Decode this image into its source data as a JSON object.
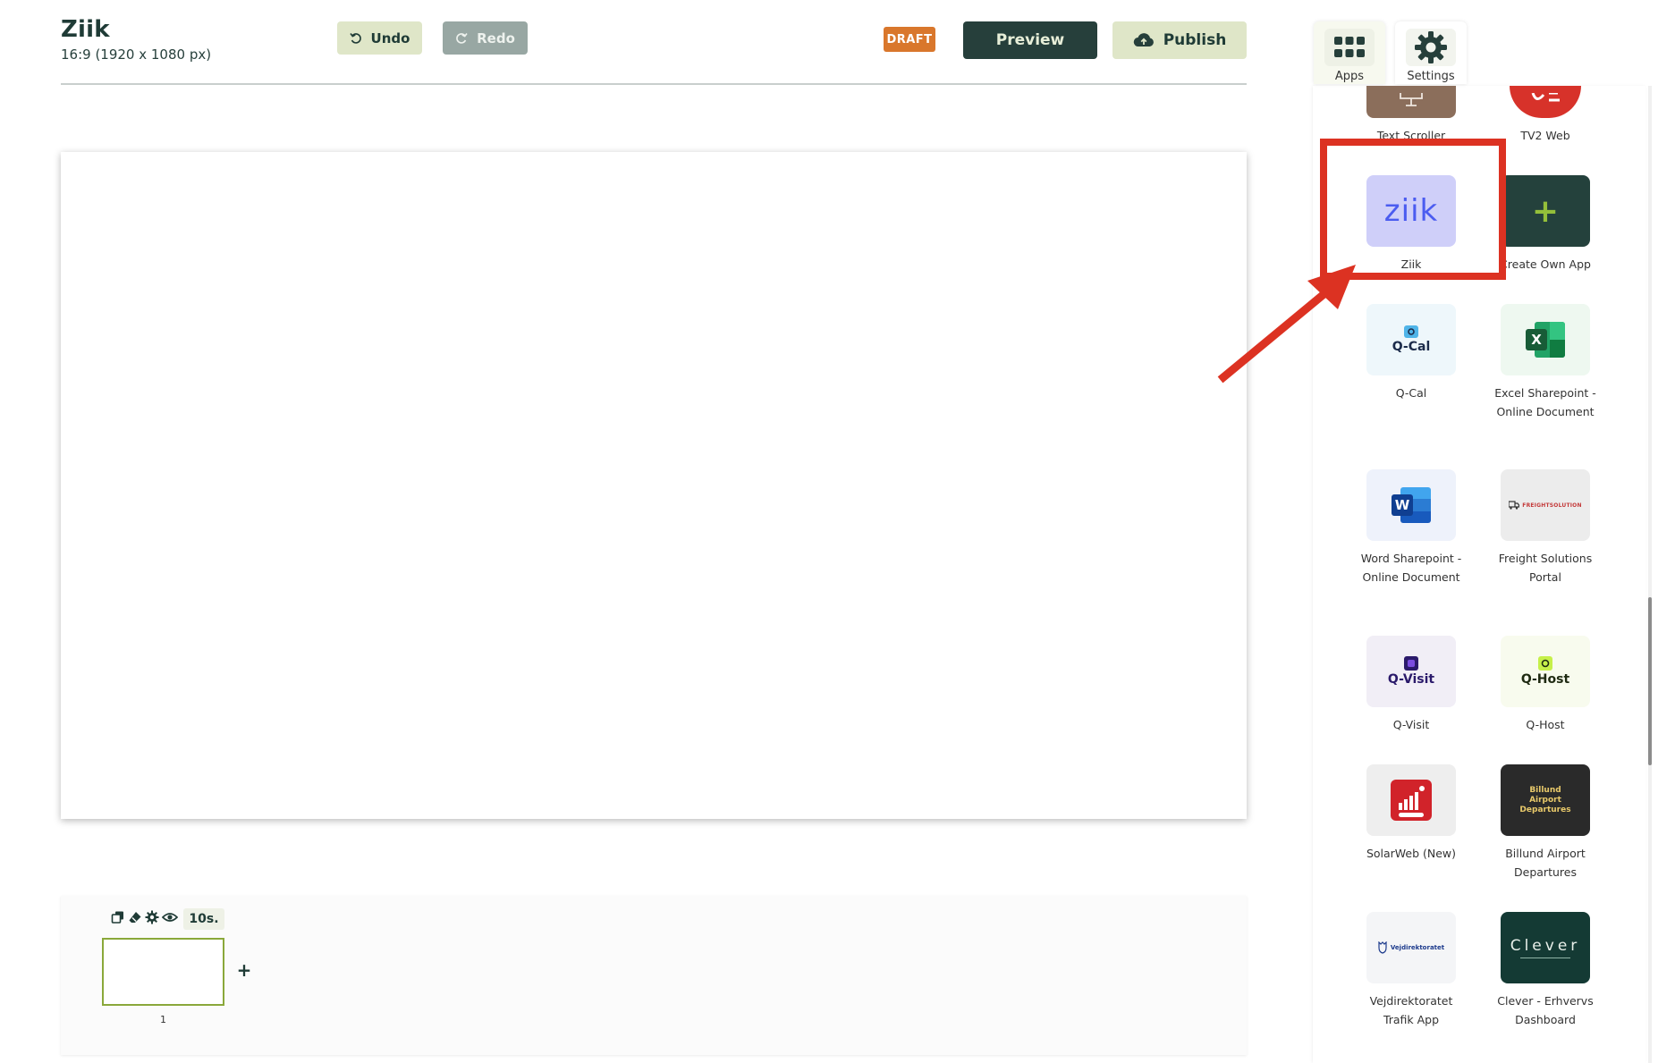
{
  "header": {
    "title": "Ziik",
    "subtitle": "16:9 (1920 x 1080 px)",
    "undo_label": "Undo",
    "redo_label": "Redo",
    "status_badge": "DRAFT",
    "preview_label": "Preview",
    "publish_label": "Publish"
  },
  "timeline": {
    "duration": "10s.",
    "slide_number": "1",
    "add_slide": "+"
  },
  "panel": {
    "tabs": [
      {
        "label": "Apps",
        "icon": "apps-grid-icon",
        "active": true
      },
      {
        "label": "Settings",
        "icon": "gear-icon",
        "active": false
      }
    ],
    "apps": [
      {
        "label": "Text Scroller"
      },
      {
        "label": "TV2 Web"
      },
      {
        "label": "Ziik",
        "logo_text": "ziik"
      },
      {
        "label": "Create Own App",
        "logo_text": "+"
      },
      {
        "label": "Q-Cal",
        "logo_text": "Q-Cal"
      },
      {
        "label": "Excel Sharepoint - Online Document",
        "logo_text": "X"
      },
      {
        "label": "Word Sharepoint - Online Document",
        "logo_text": "W"
      },
      {
        "label": "Freight Solutions Portal",
        "logo_text": "FREIGHTSOLUTION"
      },
      {
        "label": "Q-Visit",
        "logo_text": "Q-Visit"
      },
      {
        "label": "Q-Host",
        "logo_text": "Q-Host"
      },
      {
        "label": "SolarWeb (New)"
      },
      {
        "label": "Billund Airport Departures",
        "logo_text": "Billund Airport Departures"
      },
      {
        "label": "Vejdirektoratet Trafik App",
        "logo_text": "Vejdirektoratet"
      },
      {
        "label": "Clever - Erhvervs Dashboard",
        "logo_text": "Clever"
      }
    ]
  },
  "colors": {
    "brand_dark": "#263f3b",
    "brand_light": "#dfe6c8",
    "draft_orange": "#d9772c",
    "annotation_red": "#dc3222",
    "slide_selected_border": "#8aa83a"
  }
}
